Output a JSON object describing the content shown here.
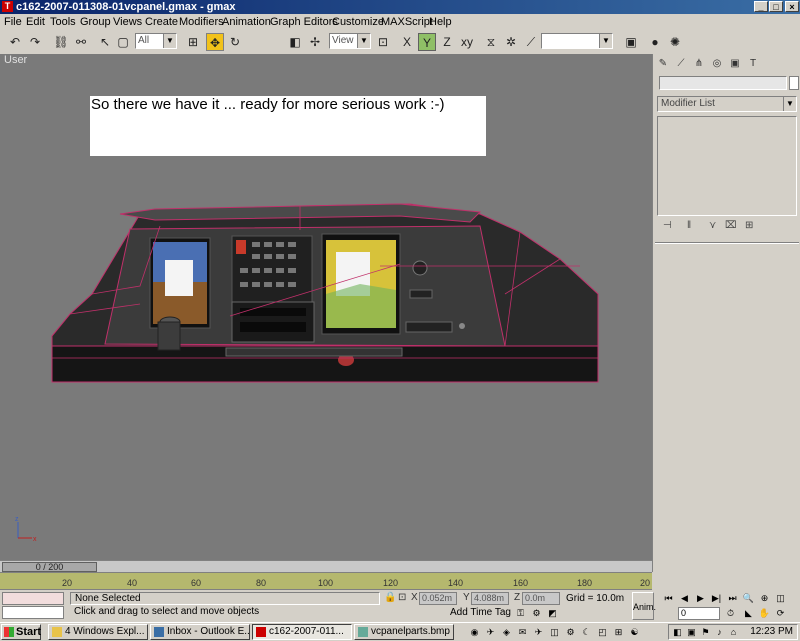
{
  "window": {
    "title": "c162-2007-011308-01vcpanel.gmax - gmax",
    "controls": [
      "_",
      "□",
      "×"
    ]
  },
  "menu": [
    "File",
    "Edit",
    "Tools",
    "Group",
    "Views",
    "Create",
    "Modifiers",
    "Animation",
    "Graph Editors",
    "Customize",
    "MAXScript",
    "Help"
  ],
  "toolbar": {
    "selection_filter": "All",
    "reference_coord": "View",
    "named_selection": ""
  },
  "viewport": {
    "label": "User",
    "note": "So there we have it ... ready for more serious work :-)"
  },
  "command_panel": {
    "modifier_list": "Modifier List"
  },
  "timeline": {
    "slider": "0 / 200",
    "ticks": [
      "20",
      "40",
      "60",
      "80",
      "100",
      "120",
      "140",
      "160",
      "180",
      "20"
    ]
  },
  "status": {
    "selection": "None Selected",
    "prompt": "Click and drag to select and move objects",
    "x_label": "X",
    "x_value": "0.052m",
    "y_label": "Y",
    "y_value": "4.088m",
    "z_label": "Z",
    "z_value": "0.0m",
    "grid": "Grid = 10.0m",
    "add_time_tag": "Add Time Tag",
    "anim": "Anim.",
    "frame": "0"
  },
  "taskbar": {
    "start": "Start",
    "tasks": [
      "4 Windows Expl...",
      "Inbox - Outlook E...",
      "c162-2007-011...",
      "vcpanelparts.bmp ..."
    ],
    "clock": "12:23 PM"
  },
  "colors": {
    "titlebar": "#0a246a",
    "viewport": "#7a7a7a",
    "wireframe": "#c0306a",
    "timeline": "#b5b86e"
  }
}
